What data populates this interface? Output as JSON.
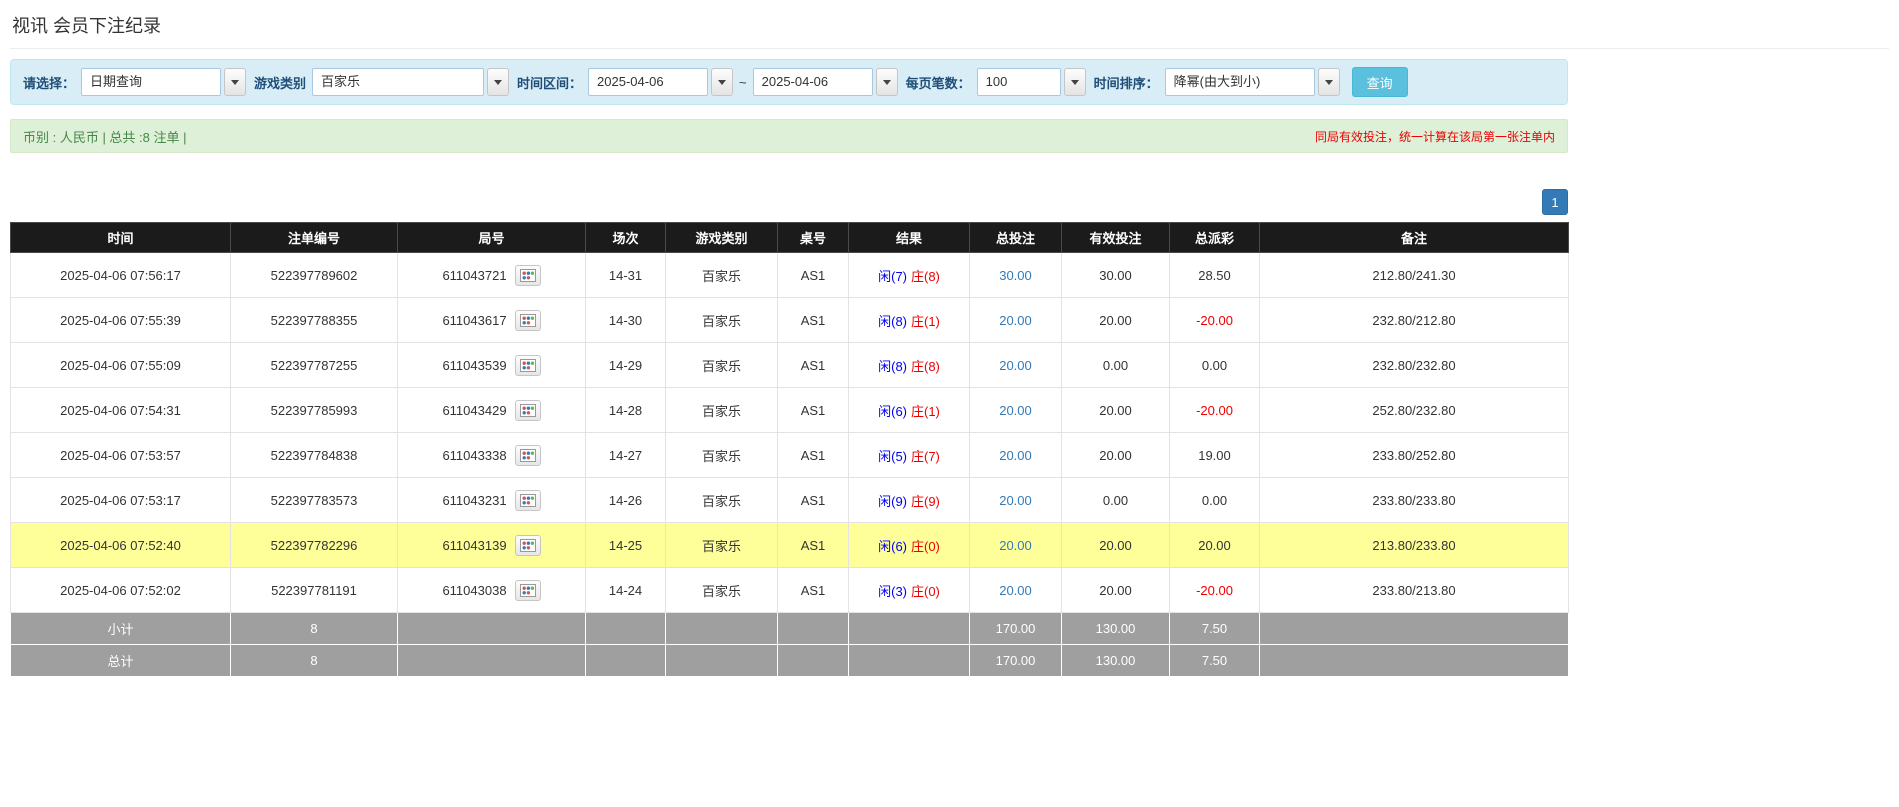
{
  "page": {
    "title": "视讯 会员下注纪录"
  },
  "filters": {
    "select_label": "请选择：",
    "select_value": "日期查询",
    "game_type_label": "游戏类别",
    "game_type_value": "百家乐",
    "date_range_label": "时间区间：",
    "date_from": "2025-04-06",
    "date_separator": "~",
    "date_to": "2025-04-06",
    "page_size_label": "每页笔数：",
    "page_size_value": "100",
    "sort_label": "时间排序：",
    "sort_value": "降幂(由大到小)",
    "search_button": "查询"
  },
  "summary": {
    "left": "币别 : 人民币 | 总共 :8 注单 |",
    "right": "同局有效投注，统一计算在该局第一张注单内"
  },
  "pagination": {
    "current": "1"
  },
  "icons": {
    "combo_arrow": "chevron-down",
    "round_detail": "roadmap-thumbnail"
  },
  "colors": {
    "filter_bar_bg": "#d9edf7",
    "summary_bar_bg": "#dff0d8",
    "summary_text": "#468847",
    "notice_red": "#ee0000",
    "search_button": "#5bc0de",
    "pagination_active": "#337ab7",
    "table_header_bg": "#1b1b1b",
    "highlight_row": "#ffff99",
    "player_blue": "#0000ee",
    "banker_red": "#ee0000",
    "bet_link_blue": "#337ab7",
    "negative_red": "#ee0000",
    "footer_bg": "#9f9f9f"
  },
  "table": {
    "headers": [
      "时间",
      "注单编号",
      "局号",
      "场次",
      "游戏类别",
      "桌号",
      "结果",
      "总投注",
      "有效投注",
      "总派彩",
      "备注"
    ],
    "rows": [
      {
        "time": "2025-04-06 07:56:17",
        "bet_no": "522397789602",
        "round_no": "611043721",
        "session": "14-31",
        "game": "百家乐",
        "table_no": "AS1",
        "player": "闲(7)",
        "banker": "庄(8)",
        "total_bet": "30.00",
        "valid_bet": "30.00",
        "payout": "28.50",
        "remark": "212.80/241.30",
        "highlight": false
      },
      {
        "time": "2025-04-06 07:55:39",
        "bet_no": "522397788355",
        "round_no": "611043617",
        "session": "14-30",
        "game": "百家乐",
        "table_no": "AS1",
        "player": "闲(8)",
        "banker": "庄(1)",
        "total_bet": "20.00",
        "valid_bet": "20.00",
        "payout": "-20.00",
        "remark": "232.80/212.80",
        "highlight": false
      },
      {
        "time": "2025-04-06 07:55:09",
        "bet_no": "522397787255",
        "round_no": "611043539",
        "session": "14-29",
        "game": "百家乐",
        "table_no": "AS1",
        "player": "闲(8)",
        "banker": "庄(8)",
        "total_bet": "20.00",
        "valid_bet": "0.00",
        "payout": "0.00",
        "remark": "232.80/232.80",
        "highlight": false
      },
      {
        "time": "2025-04-06 07:54:31",
        "bet_no": "522397785993",
        "round_no": "611043429",
        "session": "14-28",
        "game": "百家乐",
        "table_no": "AS1",
        "player": "闲(6)",
        "banker": "庄(1)",
        "total_bet": "20.00",
        "valid_bet": "20.00",
        "payout": "-20.00",
        "remark": "252.80/232.80",
        "highlight": false
      },
      {
        "time": "2025-04-06 07:53:57",
        "bet_no": "522397784838",
        "round_no": "611043338",
        "session": "14-27",
        "game": "百家乐",
        "table_no": "AS1",
        "player": "闲(5)",
        "banker": "庄(7)",
        "total_bet": "20.00",
        "valid_bet": "20.00",
        "payout": "19.00",
        "remark": "233.80/252.80",
        "highlight": false
      },
      {
        "time": "2025-04-06 07:53:17",
        "bet_no": "522397783573",
        "round_no": "611043231",
        "session": "14-26",
        "game": "百家乐",
        "table_no": "AS1",
        "player": "闲(9)",
        "banker": "庄(9)",
        "total_bet": "20.00",
        "valid_bet": "0.00",
        "payout": "0.00",
        "remark": "233.80/233.80",
        "highlight": false
      },
      {
        "time": "2025-04-06 07:52:40",
        "bet_no": "522397782296",
        "round_no": "611043139",
        "session": "14-25",
        "game": "百家乐",
        "table_no": "AS1",
        "player": "闲(6)",
        "banker": "庄(0)",
        "total_bet": "20.00",
        "valid_bet": "20.00",
        "payout": "20.00",
        "remark": "213.80/233.80",
        "highlight": true
      },
      {
        "time": "2025-04-06 07:52:02",
        "bet_no": "522397781191",
        "round_no": "611043038",
        "session": "14-24",
        "game": "百家乐",
        "table_no": "AS1",
        "player": "闲(3)",
        "banker": "庄(0)",
        "total_bet": "20.00",
        "valid_bet": "20.00",
        "payout": "-20.00",
        "remark": "233.80/213.80",
        "highlight": false
      }
    ],
    "footer_rows": [
      {
        "label": "小计",
        "count": "8",
        "total_bet": "170.00",
        "valid_bet": "130.00",
        "payout": "7.50"
      },
      {
        "label": "总计",
        "count": "8",
        "total_bet": "170.00",
        "valid_bet": "130.00",
        "payout": "7.50"
      }
    ]
  }
}
